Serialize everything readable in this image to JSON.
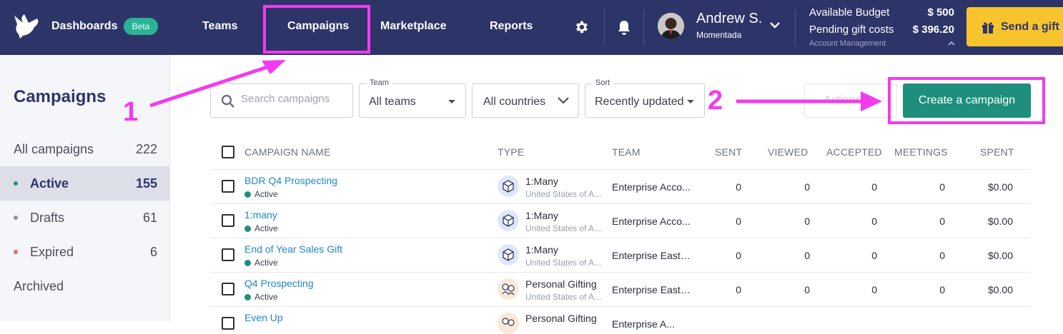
{
  "nav": {
    "dashboards": "Dashboards",
    "beta": "Beta",
    "teams": "Teams",
    "campaigns": "Campaigns",
    "marketplace": "Marketplace",
    "reports": "Reports"
  },
  "user": {
    "name": "Andrew S.",
    "org": "Momentada"
  },
  "budget": {
    "available_label": "Available Budget",
    "available_value": "$ 500",
    "pending_label": "Pending gift costs",
    "pending_value": "$ 396.20",
    "account_management": "Account Management"
  },
  "send_gift": "Send a gift",
  "sidebar": {
    "title": "Campaigns",
    "items": [
      {
        "label": "All campaigns",
        "count": "222"
      },
      {
        "label": "Active",
        "count": "155"
      },
      {
        "label": "Drafts",
        "count": "61"
      },
      {
        "label": "Expired",
        "count": "6"
      },
      {
        "label": "Archived",
        "count": ""
      }
    ]
  },
  "filters": {
    "search_placeholder": "Search campaigns",
    "team_label": "Team",
    "team_value": "All teams",
    "countries_value": "All countries",
    "sort_label": "Sort",
    "sort_value": "Recently updated",
    "actions": "Actions",
    "create": "Create a campaign"
  },
  "table": {
    "headers": [
      "CAMPAIGN NAME",
      "TYPE",
      "TEAM",
      "SENT",
      "VIEWED",
      "ACCEPTED",
      "MEETINGS",
      "SPENT"
    ],
    "rows": [
      {
        "name": "BDR Q4 Prospecting",
        "status": "Active",
        "type": "1:Many",
        "country": "United States of A...",
        "team": "Enterprise Acco...",
        "sent": "0",
        "viewed": "0",
        "accepted": "0",
        "meetings": "0",
        "spent": "$0.00"
      },
      {
        "name": "1:many",
        "status": "Active",
        "type": "1:Many",
        "country": "United States of A...",
        "team": "Enterprise Acco...",
        "sent": "0",
        "viewed": "0",
        "accepted": "0",
        "meetings": "0",
        "spent": "$0.00"
      },
      {
        "name": "End of Year Sales Gift",
        "status": "Active",
        "type": "1:Many",
        "country": "United States of A...",
        "team": "Enterprise East-...",
        "sent": "0",
        "viewed": "0",
        "accepted": "0",
        "meetings": "0",
        "spent": "$0.00"
      },
      {
        "name": "Q4 Prospecting",
        "status": "Active",
        "type": "Personal Gifting",
        "country": "United States of A...",
        "team": "Enterprise East-...",
        "sent": "0",
        "viewed": "0",
        "accepted": "0",
        "meetings": "0",
        "spent": "$0.00"
      },
      {
        "name": "Even Up",
        "status": "",
        "type": "Personal Gifting",
        "country": "",
        "team": "Enterprise A...",
        "sent": "",
        "viewed": "",
        "accepted": "",
        "meetings": "",
        "spent": ""
      }
    ]
  },
  "annotations": {
    "step1": "1",
    "step2": "2"
  },
  "colors": {
    "topbar": "#2d3568",
    "accent_green": "#1e8f7c",
    "gift_yellow": "#f7c42e",
    "annotation_magenta": "#f23bf0",
    "link_blue": "#1f87c8"
  }
}
